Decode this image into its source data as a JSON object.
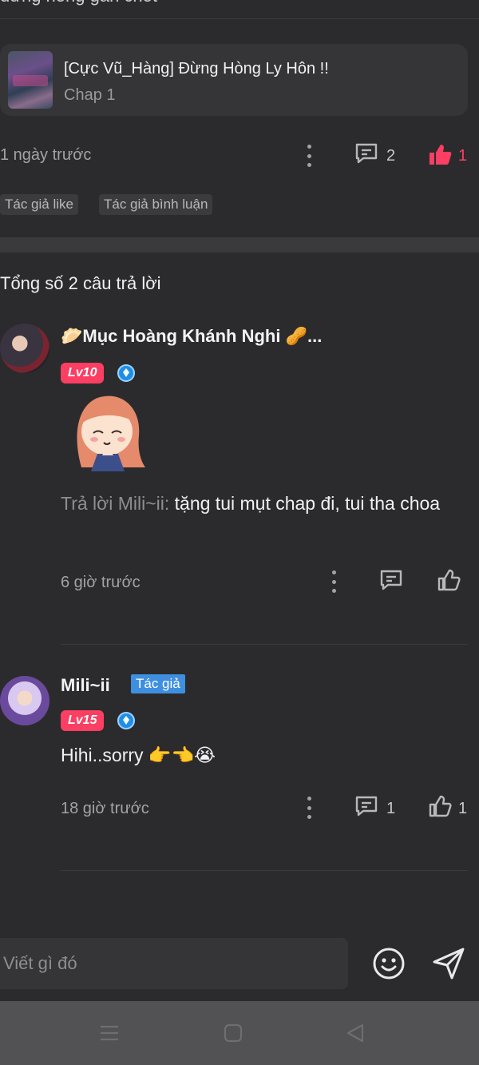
{
  "top_partial_text": "đừng hóng gấn chốt",
  "chapter_card": {
    "title": "[Cực Vũ_Hàng] Đừng Hòng Ly Hôn !!",
    "subtitle": "Chap 1"
  },
  "parent_comment": {
    "time": "1 ngày trước",
    "reply_count": "2",
    "like_count": "1",
    "tags": [
      "Tác giả like",
      "Tác giả bình luận"
    ]
  },
  "replies_header": "Tổng số 2 câu trả lời",
  "replies": [
    {
      "username": "🥟Mục Hoàng Khánh Nghi 🥜...",
      "level": "Lv10",
      "reply_prefix": "Trả lời Mili~ii:",
      "text": " tặng tui mụt chap đi, tui tha choa",
      "time": "6 giờ trước"
    },
    {
      "username": "Mili~ii",
      "author_badge": "Tác giả",
      "level": "Lv15",
      "text": "Hihi..sorry 👉👈😭",
      "time": "18 giờ trước",
      "reply_count": "1",
      "like_count": "1"
    }
  ],
  "input": {
    "placeholder": "Viết gì đó"
  },
  "colors": {
    "background": "#2b2b2d",
    "accent_red": "#ff3e63",
    "author_blue": "#3f8fe0"
  },
  "icons": [
    "comment-icon",
    "like-icon",
    "more-icon",
    "emoji-icon",
    "send-icon",
    "menu-icon",
    "home-icon",
    "back-icon"
  ]
}
